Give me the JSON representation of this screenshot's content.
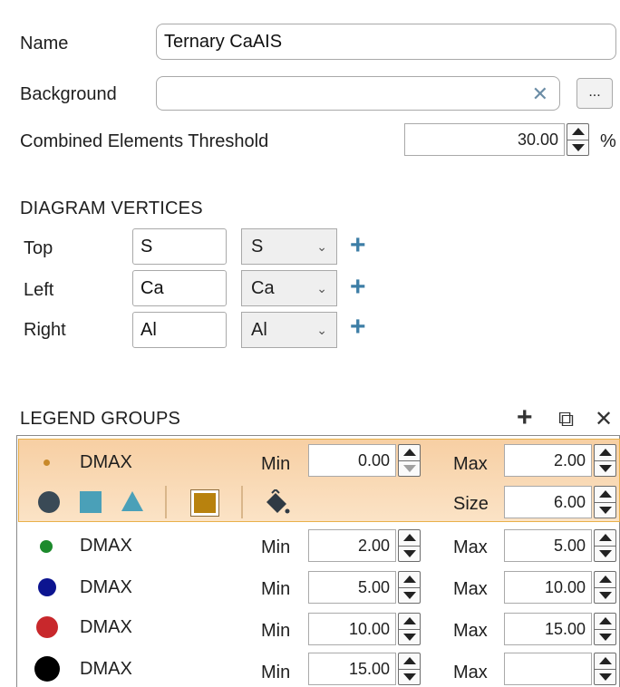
{
  "form": {
    "name_label": "Name",
    "name_value": "Ternary CaAIS",
    "background_label": "Background",
    "background_value": "",
    "clear_icon": "✕",
    "browse_label": "...",
    "threshold_label": "Combined Elements Threshold",
    "threshold_value": "30.00",
    "threshold_unit": "%"
  },
  "vertices": {
    "section_title": "DIAGRAM VERTICES",
    "rows": [
      {
        "label": "Top",
        "value": "S",
        "select": "S"
      },
      {
        "label": "Left",
        "value": "Ca",
        "select": "Ca"
      },
      {
        "label": "Right",
        "value": "Al",
        "select": "Al"
      }
    ],
    "chevron": "⌄",
    "plus": "+"
  },
  "legend": {
    "section_title": "LEGEND GROUPS",
    "header_icons": [
      "add-icon",
      "copy-icon",
      "delete-icon"
    ],
    "header_glyphs": {
      "add": "+",
      "copy": "⧉",
      "delete": "✕"
    },
    "min_label": "Min",
    "max_label": "Max",
    "size_label": "Size",
    "selected_size": "6.00",
    "groups": [
      {
        "name": "DMAX",
        "color": "#c8892a",
        "min": "0.00",
        "max": "2.00",
        "selected": true
      },
      {
        "name": "DMAX",
        "color": "#1c8a2c",
        "min": "2.00",
        "max": "5.00"
      },
      {
        "name": "DMAX",
        "color": "#0c1490",
        "min": "5.00",
        "max": "10.00"
      },
      {
        "name": "DMAX",
        "color": "#c8282c",
        "min": "10.00",
        "max": "15.00"
      },
      {
        "name": "DMAX",
        "color": "#000000",
        "min": "15.00",
        "max": ""
      }
    ],
    "shapes": {
      "circle_color": "#3a4a56",
      "square_color": "#4aa0b8",
      "triangle_color": "#4aa0b8",
      "swatch_color": "#b8820e"
    }
  }
}
